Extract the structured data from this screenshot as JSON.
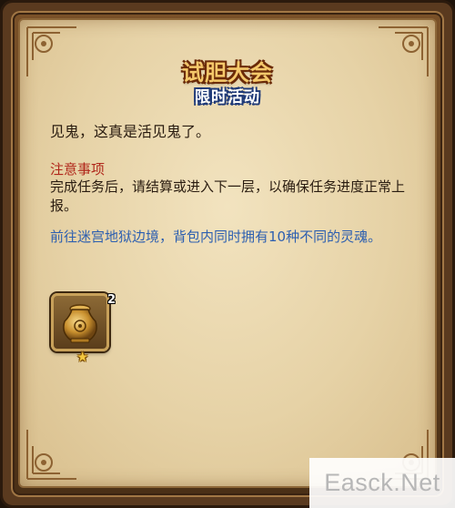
{
  "panel": {
    "title": "试胆大会",
    "subtitle": "限时活动",
    "description": "见鬼，这真是活见鬼了。",
    "notice_title": "注意事项",
    "notice_body": "完成任务后，请结算或进入下一层，以确保任务进度正常上报。",
    "goal": "前往迷宫地狱边境，背包内同时拥有10种不同的灵魂。"
  },
  "reward": {
    "icon": "golden-vase-icon",
    "count": "2",
    "star_glyph": "★"
  },
  "watermark": {
    "text": "Easck.Net"
  },
  "colors": {
    "parchment": "#e6d2a6",
    "frame": "#5a3a1f",
    "title": "#f5c96b",
    "subtitle_outline": "#1f3a78",
    "notice": "#b0261a",
    "goal": "#2d5fb0"
  }
}
